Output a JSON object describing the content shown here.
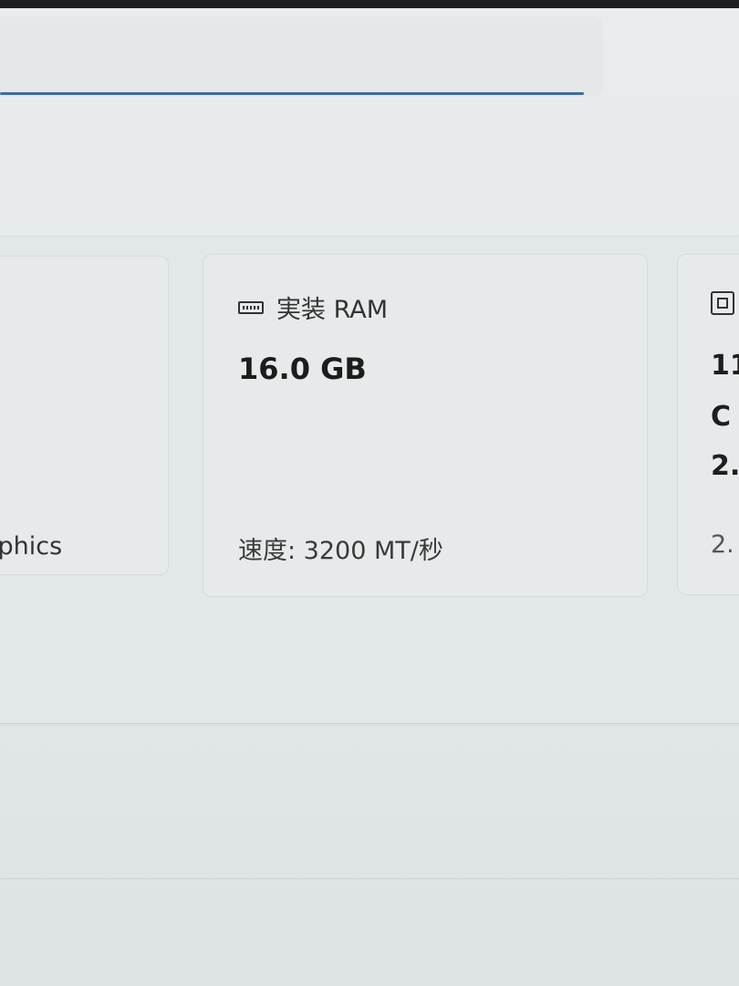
{
  "cards": {
    "left": {
      "sub": "aphics"
    },
    "ram": {
      "icon": "ram-icon",
      "label": "実装 RAM",
      "value": "16.0 GB",
      "sub": "速度: 3200 MT/秒"
    },
    "right": {
      "icon": "cpu-icon",
      "line1": "11",
      "line2": "C",
      "line3": "2.",
      "sub": "2."
    }
  },
  "colors": {
    "accent_underline": "#3f6ba3",
    "card_bg": "#e7eaeb",
    "page_bg": "#e6eaeb"
  }
}
